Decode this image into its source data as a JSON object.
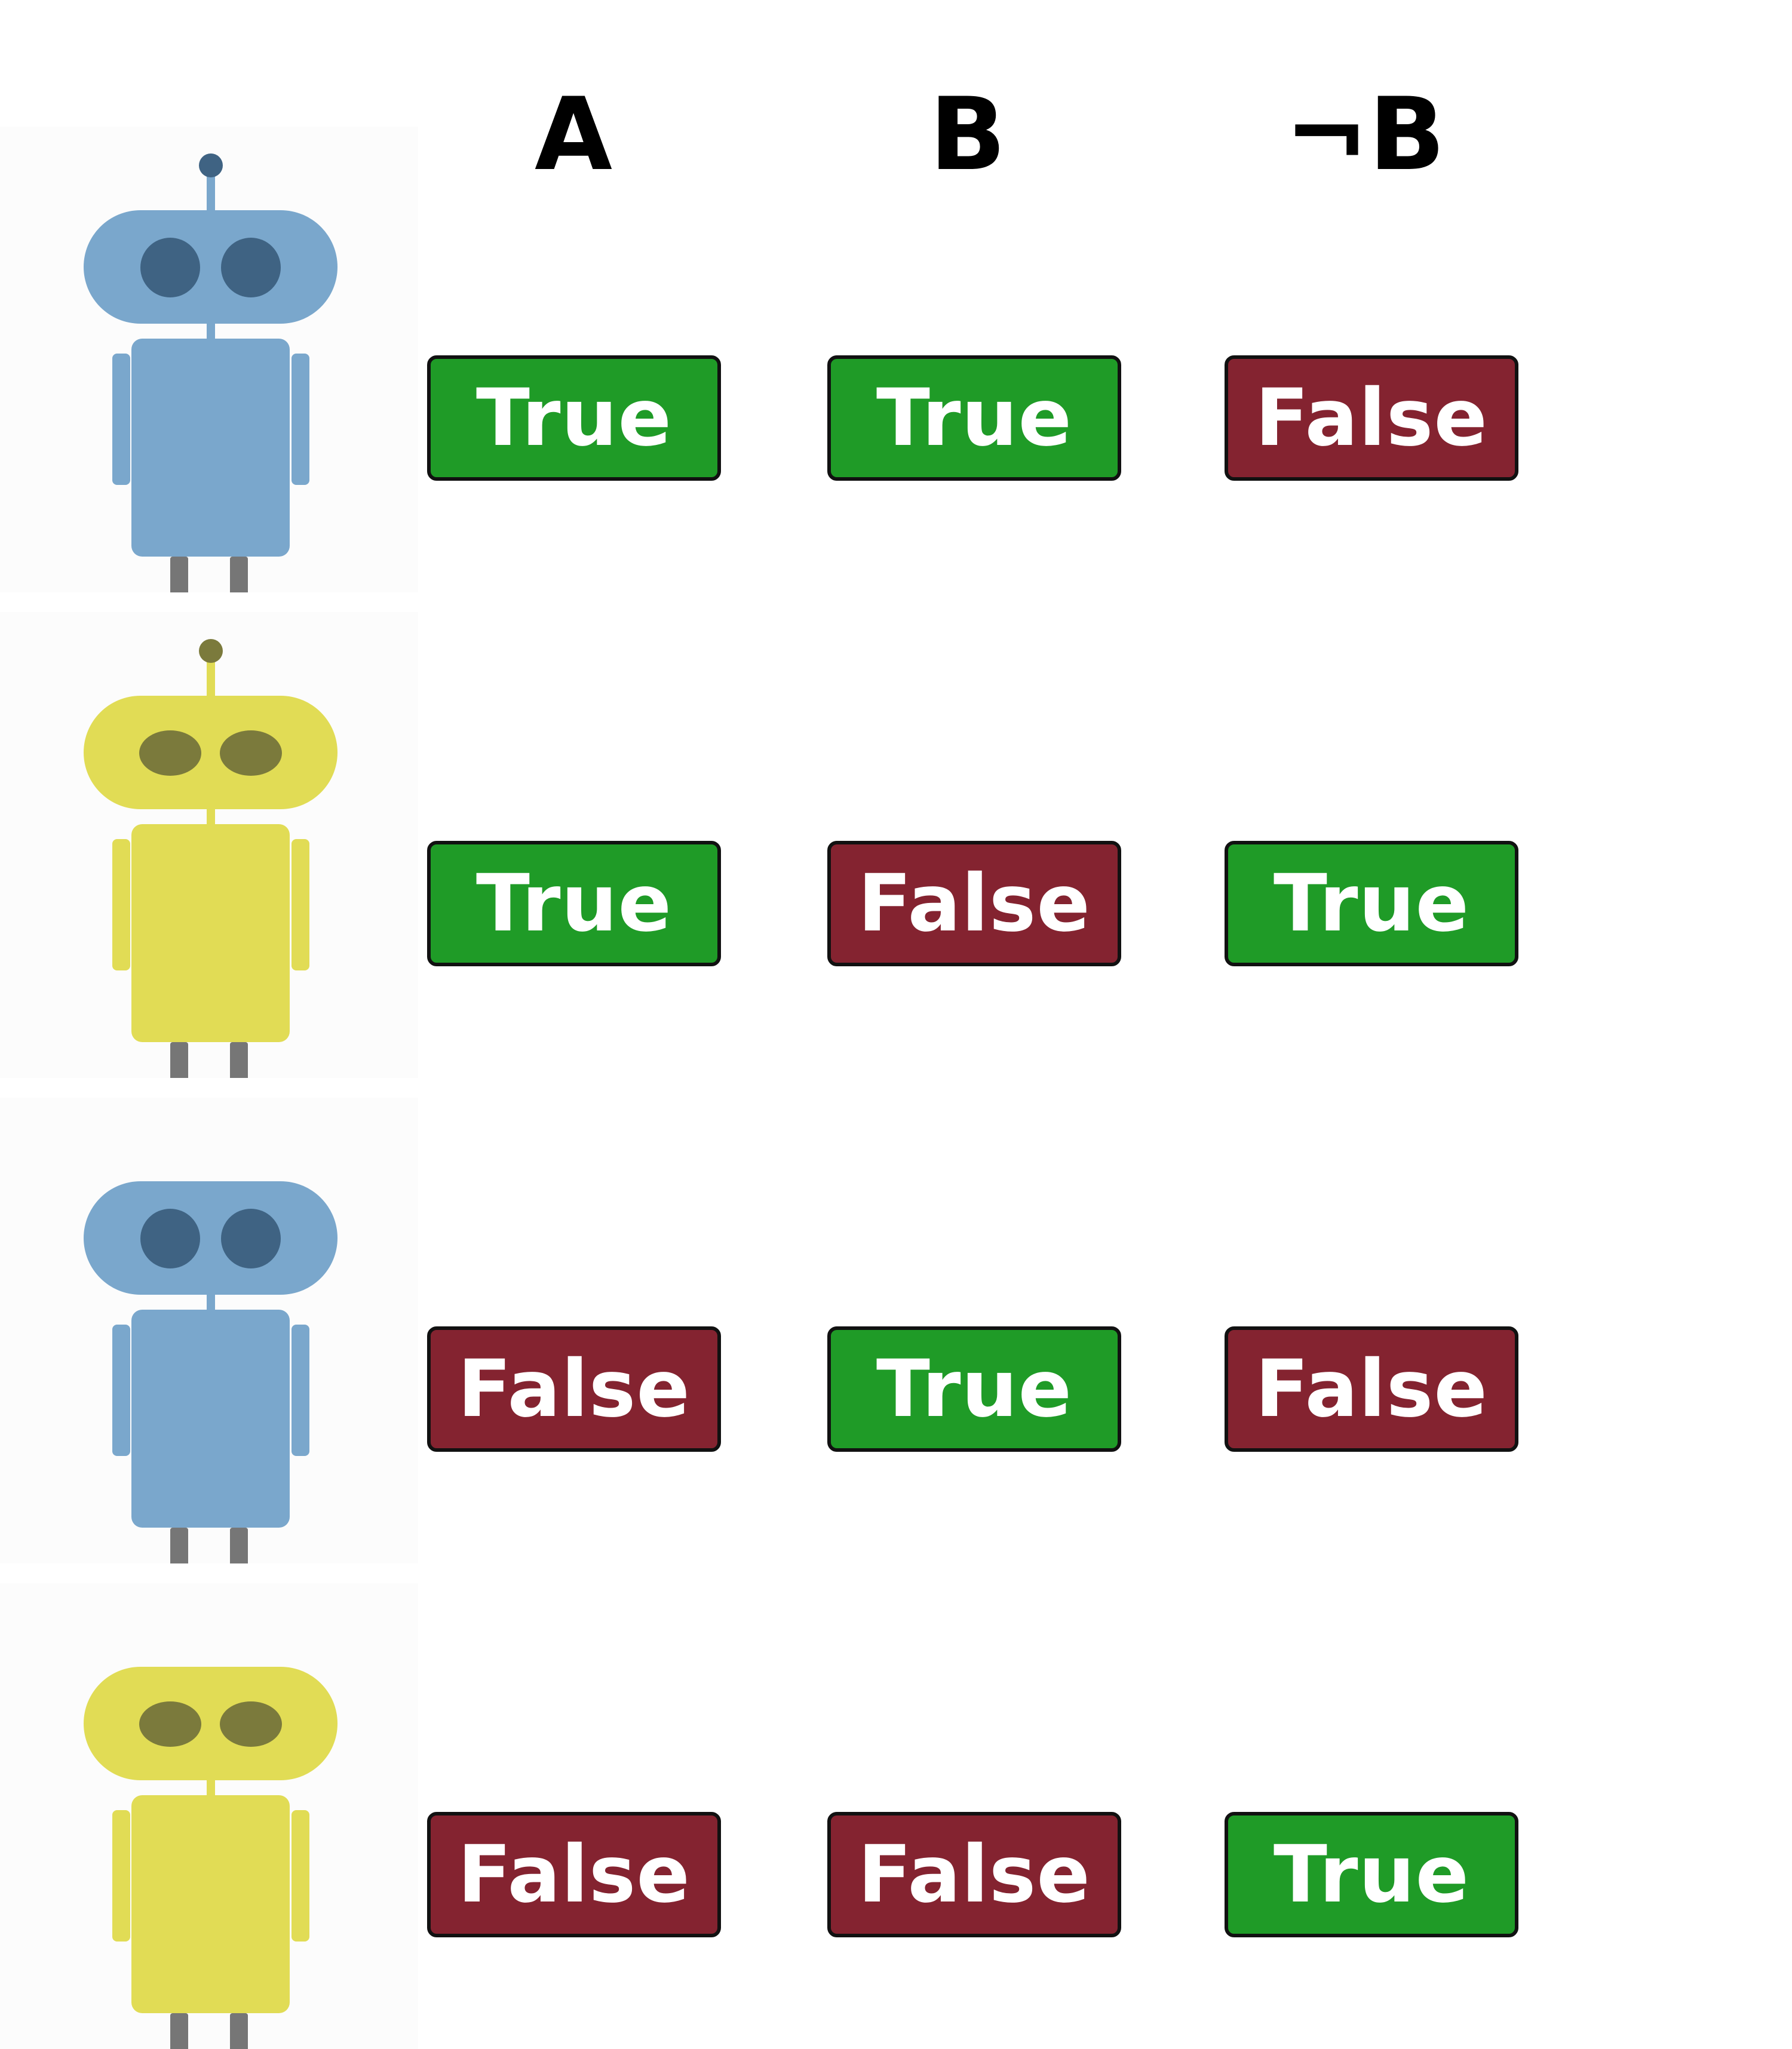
{
  "columns": [
    {
      "key": "a",
      "label": "A"
    },
    {
      "key": "b",
      "label": "B"
    },
    {
      "key": "not_b",
      "label": "¬B"
    }
  ],
  "value_labels": {
    "true": "True",
    "false": "False"
  },
  "colors": {
    "true_badge": "#1f9b27",
    "false_badge": "#842330",
    "badge_border": "#111111",
    "blue_robot_body": "#7aa7cc",
    "blue_robot_eye": "#3f6383",
    "yellow_robot_body": "#e1dc55",
    "yellow_robot_eye": "#7b7a3c",
    "robot_leg": "#767676"
  },
  "rows": [
    {
      "robot": {
        "color": "blue",
        "antenna": true
      },
      "a": true,
      "b": true,
      "not_b": false
    },
    {
      "robot": {
        "color": "yellow",
        "antenna": true
      },
      "a": true,
      "b": false,
      "not_b": true
    },
    {
      "robot": {
        "color": "blue",
        "antenna": false
      },
      "a": false,
      "b": true,
      "not_b": false
    },
    {
      "robot": {
        "color": "yellow",
        "antenna": false
      },
      "a": false,
      "b": false,
      "not_b": true
    }
  ]
}
